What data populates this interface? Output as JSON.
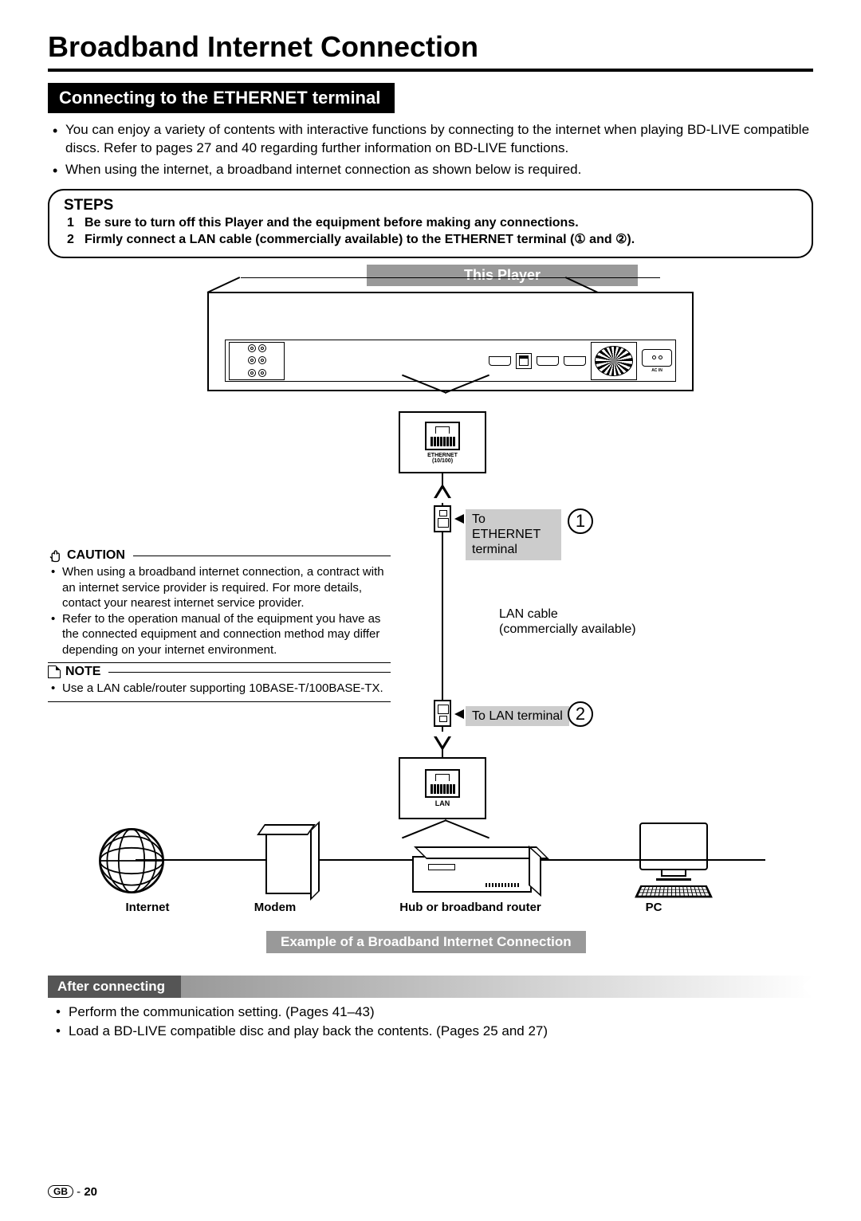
{
  "title": "Broadband Internet Connection",
  "section_heading": "Connecting to the ETHERNET terminal",
  "intro": [
    "You can enjoy a variety of contents with interactive functions by connecting to the internet when playing BD-LIVE compatible discs. Refer to pages 27 and 40 regarding further information on BD-LIVE functions.",
    "When using the internet, a broadband internet connection as shown below is required."
  ],
  "steps_heading": "STEPS",
  "steps": [
    "Be sure to turn off this Player and the equipment before making any connections.",
    "Firmly connect a LAN cable (commercially available) to the ETHERNET terminal (① and ②)."
  ],
  "diagram": {
    "player_label": "This Player",
    "ethernet_zoom": "ETHERNET\n(10/100)",
    "to_ethernet": "To ETHERNET terminal",
    "lan_cable": "LAN cable",
    "lan_cable_sub": "(commercially available)",
    "to_lan": "To LAN terminal",
    "lan_zoom": "LAN",
    "callout1": "1",
    "callout2": "2",
    "net": {
      "internet": "Internet",
      "modem": "Modem",
      "router": "Hub or broadband router",
      "pc": "PC"
    },
    "example_label": "Example of a Broadband Internet Connection"
  },
  "caution": {
    "heading": "CAUTION",
    "items": [
      "When using a broadband internet connection, a contract with an internet service provider is required. For more details, contact your nearest internet service provider.",
      "Refer to the operation manual of the equipment you have as the connected equipment and connection method may differ depending on your internet environment."
    ]
  },
  "note": {
    "heading": "NOTE",
    "items": [
      "Use a LAN cable/router supporting 10BASE-T/100BASE-TX."
    ]
  },
  "after": {
    "heading": "After connecting",
    "items": [
      "Perform the communication setting. (Pages 41–43)",
      "Load a BD-LIVE compatible disc and play back the contents. (Pages 25 and 27)"
    ]
  },
  "footer": {
    "region": "GB",
    "separator": " - ",
    "page": "20"
  }
}
